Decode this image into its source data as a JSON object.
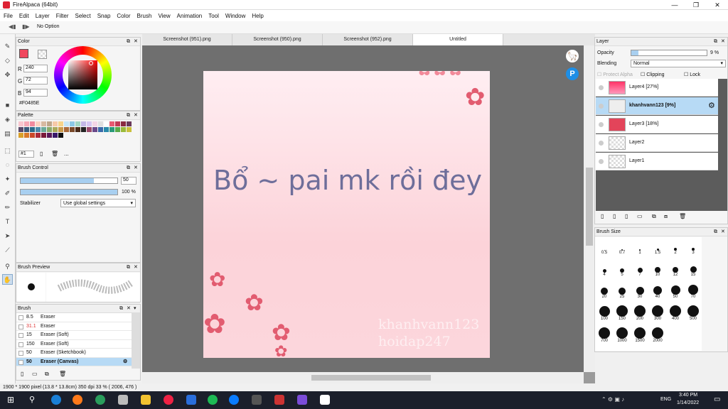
{
  "window": {
    "title": "FireAlpaca (64bit)"
  },
  "menu": [
    "File",
    "Edit",
    "Layer",
    "Filter",
    "Select",
    "Snap",
    "Color",
    "Brush",
    "View",
    "Animation",
    "Tool",
    "Window",
    "Help"
  ],
  "tool_option": "No Option",
  "color_panel": {
    "title": "Color",
    "r_label": "R",
    "g_label": "G",
    "b_label": "B",
    "r": "240",
    "g": "72",
    "b": "94",
    "hex": "#F0485E",
    "current_color": "#F0485E"
  },
  "palette": {
    "title": "Palette",
    "selector": "#1",
    "more": "..."
  },
  "brush_control": {
    "title": "Brush Control",
    "size": "50",
    "opacity": "100 %",
    "size_fraction": 0.76,
    "opacity_fraction": 1.0,
    "stabilizer_label": "Stabilizer",
    "stabilizer_value": "Use global settings"
  },
  "brush_preview": {
    "title": "Brush Preview"
  },
  "brush_list": {
    "title": "Brush",
    "items": [
      {
        "size": "8.5",
        "name": "Eraser"
      },
      {
        "size": "31.1",
        "name": "Eraser"
      },
      {
        "size": "15",
        "name": "Eraser (Soft)"
      },
      {
        "size": "150",
        "name": "Eraser (Soft)"
      },
      {
        "size": "50",
        "name": "Eraser (Sketchbook)"
      },
      {
        "size": "50",
        "name": "Eraser (Canvas)"
      }
    ]
  },
  "tabs": [
    "Screenshot (951).png",
    "Screenshot (950).png",
    "Screenshot (952).png",
    "Untitled"
  ],
  "canvas": {
    "text": "Bổ ~ pai mk rồi đey",
    "watermark1": "khanhvann123",
    "watermark2": "hoidap247"
  },
  "layer_panel": {
    "title": "Layer",
    "opacity_label": "Opacity",
    "opacity_value": "9 %",
    "opacity_fraction": 0.09,
    "blending_label": "Blending",
    "blending_value": "Normal",
    "protect_alpha": "Protect Alpha",
    "clipping": "Clipping",
    "lock": "Lock",
    "layers": [
      {
        "name": "Layer4 [27%]"
      },
      {
        "name": "khanhvann123 [9%]"
      },
      {
        "name": "Layer3 [18%]"
      },
      {
        "name": "Layer2"
      },
      {
        "name": "Layer1"
      }
    ]
  },
  "brush_size": {
    "title": "Brush Size",
    "sizes": [
      "0.5",
      "0.7",
      "1",
      "1.5",
      "2",
      "3",
      "4",
      "5",
      "7",
      "10",
      "12",
      "15",
      "20",
      "25",
      "30",
      "40",
      "50",
      "70",
      "100",
      "150",
      "200",
      "300",
      "400",
      "500",
      "700",
      "1000",
      "1500",
      "2000"
    ]
  },
  "status": "1900 * 1900 pixel   (13.8 * 13.8cm)  350 dpi  33 %  ( 2006, 476 )",
  "taskbar": {
    "time": "3:40 PM",
    "date": "1/14/2022",
    "lang": "ENG"
  }
}
